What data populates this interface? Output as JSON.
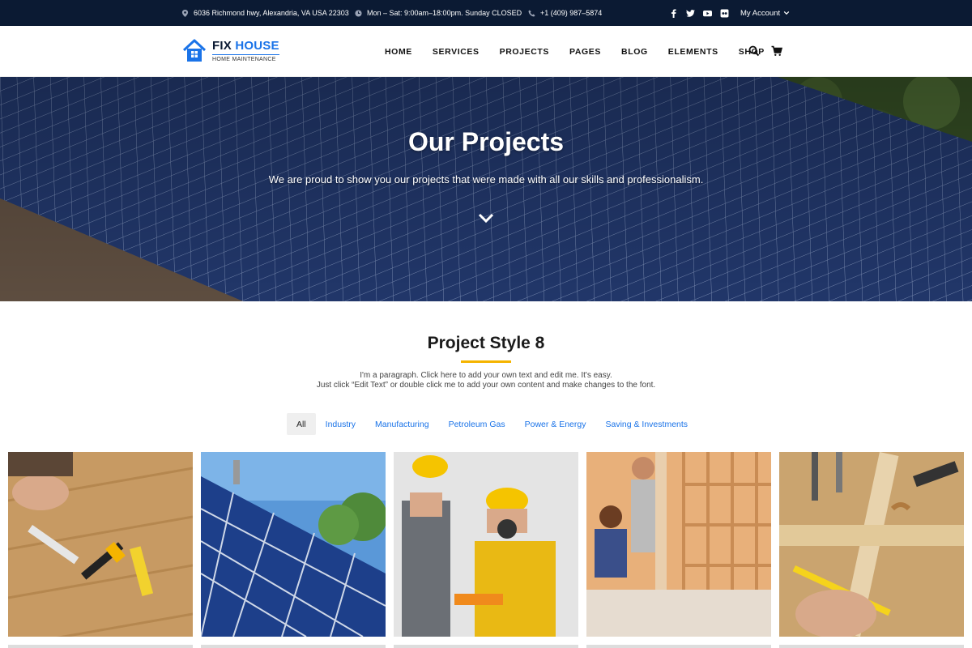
{
  "topbar": {
    "address": "6036 Richmond hwy, Alexandria, VA USA 22303",
    "hours": "Mon – Sat: 9:00am–18:00pm. Sunday CLOSED",
    "phone": "+1 (409) 987–5874",
    "social_icons": [
      "facebook-icon",
      "twitter-icon",
      "youtube-icon",
      "flickr-icon"
    ],
    "account_label": "My Account"
  },
  "header": {
    "logo_word1": "FIX",
    "logo_word2": "HOUSE",
    "logo_sub": "HOME MAINTENANCE",
    "nav": [
      "HOME",
      "SERVICES",
      "PROJECTS",
      "PAGES",
      "BLOG",
      "ELEMENTS",
      "SHOP"
    ]
  },
  "hero": {
    "title": "Our Projects",
    "subtitle": "We are proud to show you our projects that were made with all our skills and professionalism."
  },
  "section": {
    "title": "Project Style 8",
    "line1": "I'm a paragraph. Click here to add your own text and edit me. It's easy.",
    "line2": "Just click “Edit Text” or double click me to add your own content and make changes to the font."
  },
  "filters": [
    "All",
    "Industry",
    "Manufacturing",
    "Petroleum Gas",
    "Power & Energy",
    "Saving & Investments"
  ],
  "colors": {
    "topbar_bg": "#0b1a33",
    "accent_blue": "#1a73e8",
    "accent_yellow": "#f5b400"
  }
}
